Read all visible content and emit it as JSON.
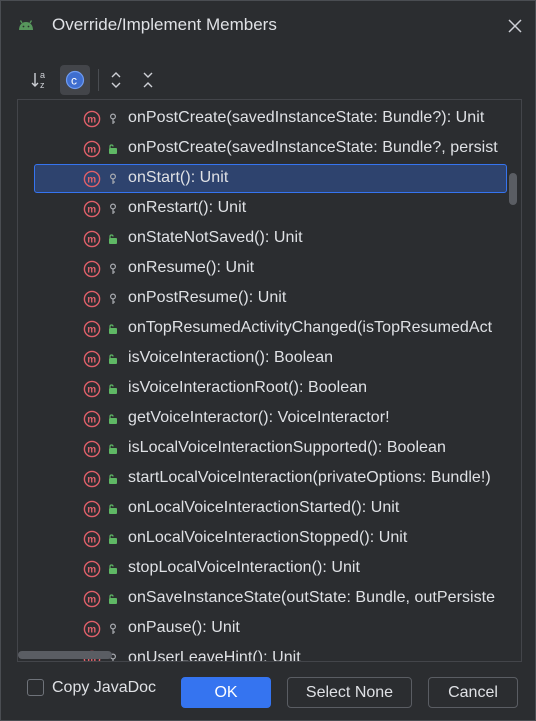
{
  "dialog": {
    "title": "Override/Implement Members",
    "title_icon": "android-icon",
    "close_icon": "close-icon"
  },
  "toolbar": {
    "buttons": [
      {
        "name": "sort-alphabetically-icon",
        "active": false
      },
      {
        "name": "group-by-class-icon",
        "active": true
      },
      {
        "name": "expand-all-icon",
        "active": false
      },
      {
        "name": "collapse-all-icon",
        "active": false
      }
    ]
  },
  "colors": {
    "method_icon": "#e0606a",
    "lock_icon": "#5fb865",
    "key_icon": "#a8abb0",
    "selection": "#2e436e",
    "accent": "#3574f0"
  },
  "members": [
    {
      "label": "onPostCreate(savedInstanceState: Bundle?): Unit",
      "visibility": "key-icon",
      "selected": false
    },
    {
      "label": "onPostCreate(savedInstanceState: Bundle?, persist",
      "visibility": "lock-icon",
      "selected": false
    },
    {
      "label": "onStart(): Unit",
      "visibility": "key-icon",
      "selected": true
    },
    {
      "label": "onRestart(): Unit",
      "visibility": "key-icon",
      "selected": false
    },
    {
      "label": "onStateNotSaved(): Unit",
      "visibility": "lock-icon",
      "selected": false
    },
    {
      "label": "onResume(): Unit",
      "visibility": "key-icon",
      "selected": false
    },
    {
      "label": "onPostResume(): Unit",
      "visibility": "key-icon",
      "selected": false
    },
    {
      "label": "onTopResumedActivityChanged(isTopResumedAct",
      "visibility": "lock-icon",
      "selected": false
    },
    {
      "label": "isVoiceInteraction(): Boolean",
      "visibility": "lock-icon",
      "selected": false
    },
    {
      "label": "isVoiceInteractionRoot(): Boolean",
      "visibility": "lock-icon",
      "selected": false
    },
    {
      "label": "getVoiceInteractor(): VoiceInteractor!",
      "visibility": "lock-icon",
      "selected": false
    },
    {
      "label": "isLocalVoiceInteractionSupported(): Boolean",
      "visibility": "lock-icon",
      "selected": false
    },
    {
      "label": "startLocalVoiceInteraction(privateOptions: Bundle!)",
      "visibility": "lock-icon",
      "selected": false
    },
    {
      "label": "onLocalVoiceInteractionStarted(): Unit",
      "visibility": "lock-icon",
      "selected": false
    },
    {
      "label": "onLocalVoiceInteractionStopped(): Unit",
      "visibility": "lock-icon",
      "selected": false
    },
    {
      "label": "stopLocalVoiceInteraction(): Unit",
      "visibility": "lock-icon",
      "selected": false
    },
    {
      "label": "onSaveInstanceState(outState: Bundle, outPersiste",
      "visibility": "lock-icon",
      "selected": false
    },
    {
      "label": "onPause(): Unit",
      "visibility": "key-icon",
      "selected": false
    },
    {
      "label": "onUserLeaveHint(): Unit",
      "visibility": "key-icon",
      "selected": false
    }
  ],
  "footer": {
    "copy_javadoc_label": "Copy JavaDoc",
    "copy_javadoc_checked": false,
    "ok_label": "OK",
    "select_none_label": "Select None",
    "cancel_label": "Cancel"
  }
}
